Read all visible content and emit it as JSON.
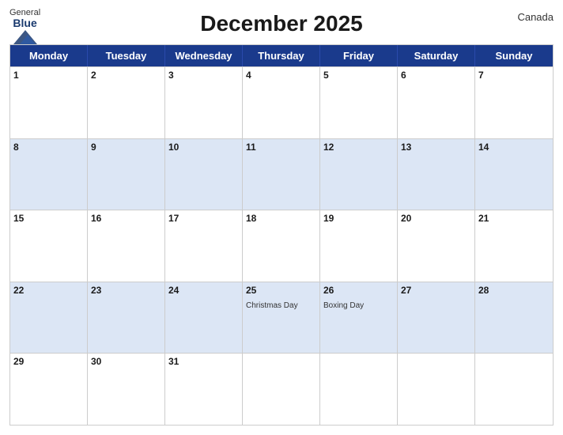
{
  "header": {
    "title": "December 2025",
    "country": "Canada",
    "logo": {
      "general": "General",
      "blue": "Blue"
    }
  },
  "days": {
    "headers": [
      "Monday",
      "Tuesday",
      "Wednesday",
      "Thursday",
      "Friday",
      "Saturday",
      "Sunday"
    ]
  },
  "weeks": [
    [
      {
        "num": "1",
        "events": []
      },
      {
        "num": "2",
        "events": []
      },
      {
        "num": "3",
        "events": []
      },
      {
        "num": "4",
        "events": []
      },
      {
        "num": "5",
        "events": []
      },
      {
        "num": "6",
        "events": []
      },
      {
        "num": "7",
        "events": []
      }
    ],
    [
      {
        "num": "8",
        "events": []
      },
      {
        "num": "9",
        "events": []
      },
      {
        "num": "10",
        "events": []
      },
      {
        "num": "11",
        "events": []
      },
      {
        "num": "12",
        "events": []
      },
      {
        "num": "13",
        "events": []
      },
      {
        "num": "14",
        "events": []
      }
    ],
    [
      {
        "num": "15",
        "events": []
      },
      {
        "num": "16",
        "events": []
      },
      {
        "num": "17",
        "events": []
      },
      {
        "num": "18",
        "events": []
      },
      {
        "num": "19",
        "events": []
      },
      {
        "num": "20",
        "events": []
      },
      {
        "num": "21",
        "events": []
      }
    ],
    [
      {
        "num": "22",
        "events": []
      },
      {
        "num": "23",
        "events": []
      },
      {
        "num": "24",
        "events": []
      },
      {
        "num": "25",
        "events": [
          "Christmas Day"
        ]
      },
      {
        "num": "26",
        "events": [
          "Boxing Day"
        ]
      },
      {
        "num": "27",
        "events": []
      },
      {
        "num": "28",
        "events": []
      }
    ],
    [
      {
        "num": "29",
        "events": []
      },
      {
        "num": "30",
        "events": []
      },
      {
        "num": "31",
        "events": []
      },
      {
        "num": "",
        "events": []
      },
      {
        "num": "",
        "events": []
      },
      {
        "num": "",
        "events": []
      },
      {
        "num": "",
        "events": []
      }
    ]
  ]
}
